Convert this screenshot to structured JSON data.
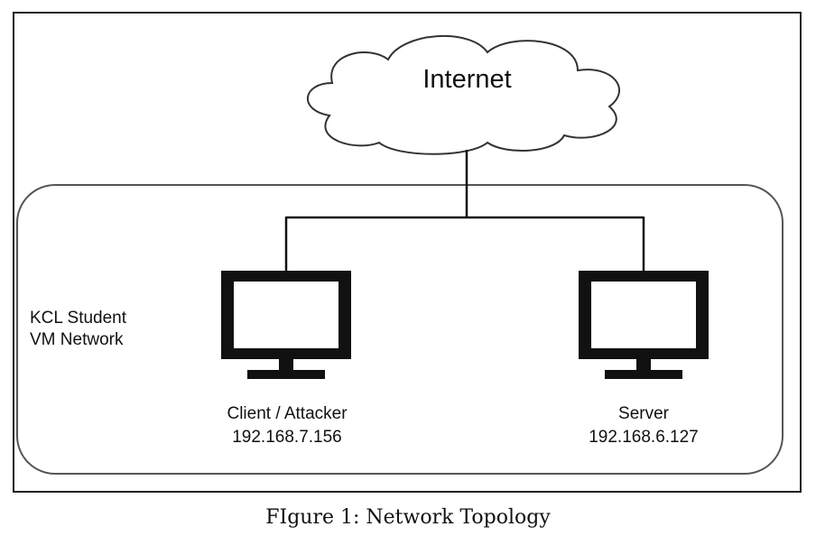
{
  "diagram": {
    "network_label_line1": "KCL Student",
    "network_label_line2": "VM Network",
    "internet_label": "Internet",
    "client": {
      "name": "Client / Attacker",
      "ip": "192.168.7.156"
    },
    "server": {
      "name": "Server",
      "ip": "192.168.6.127"
    }
  },
  "caption": "FIgure 1: Network Topology"
}
